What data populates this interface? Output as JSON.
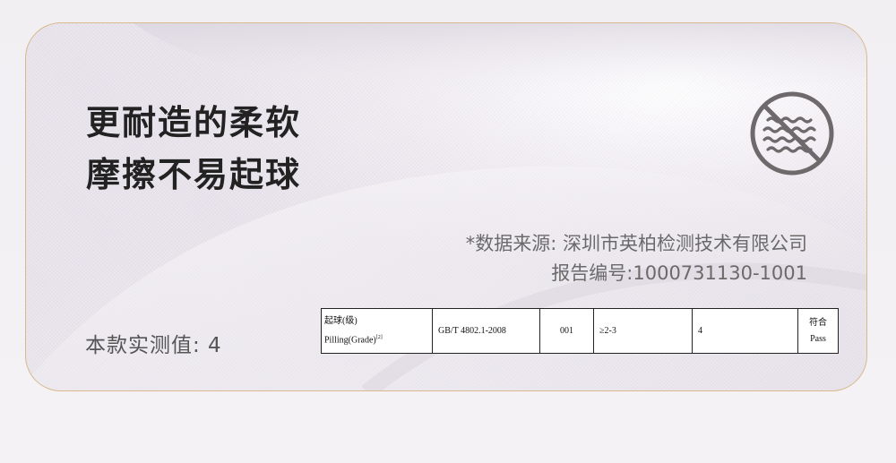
{
  "headline": {
    "line1": "更耐造的柔软",
    "line2": "摩擦不易起球"
  },
  "icon": {
    "name": "no-pilling-icon",
    "color": "#6e6a6c"
  },
  "source": {
    "line1": "*数据来源: 深圳市英柏检测技术有限公司",
    "line2": "报告编号:1000731130-1001"
  },
  "measured": "本款实测值: 4",
  "table": {
    "item_cn": "起球(级)",
    "item_en": "Pilling(Grade)",
    "item_sup": "[2]",
    "standard": "GB/T 4802.1-2008",
    "sample": "001",
    "requirement": "≥2-3",
    "result": "4",
    "verdict_cn": "符合",
    "verdict_en": "Pass"
  },
  "colors": {
    "border": "#d8b98e",
    "headline": "#222222",
    "source_text": "#6a6a6a"
  }
}
